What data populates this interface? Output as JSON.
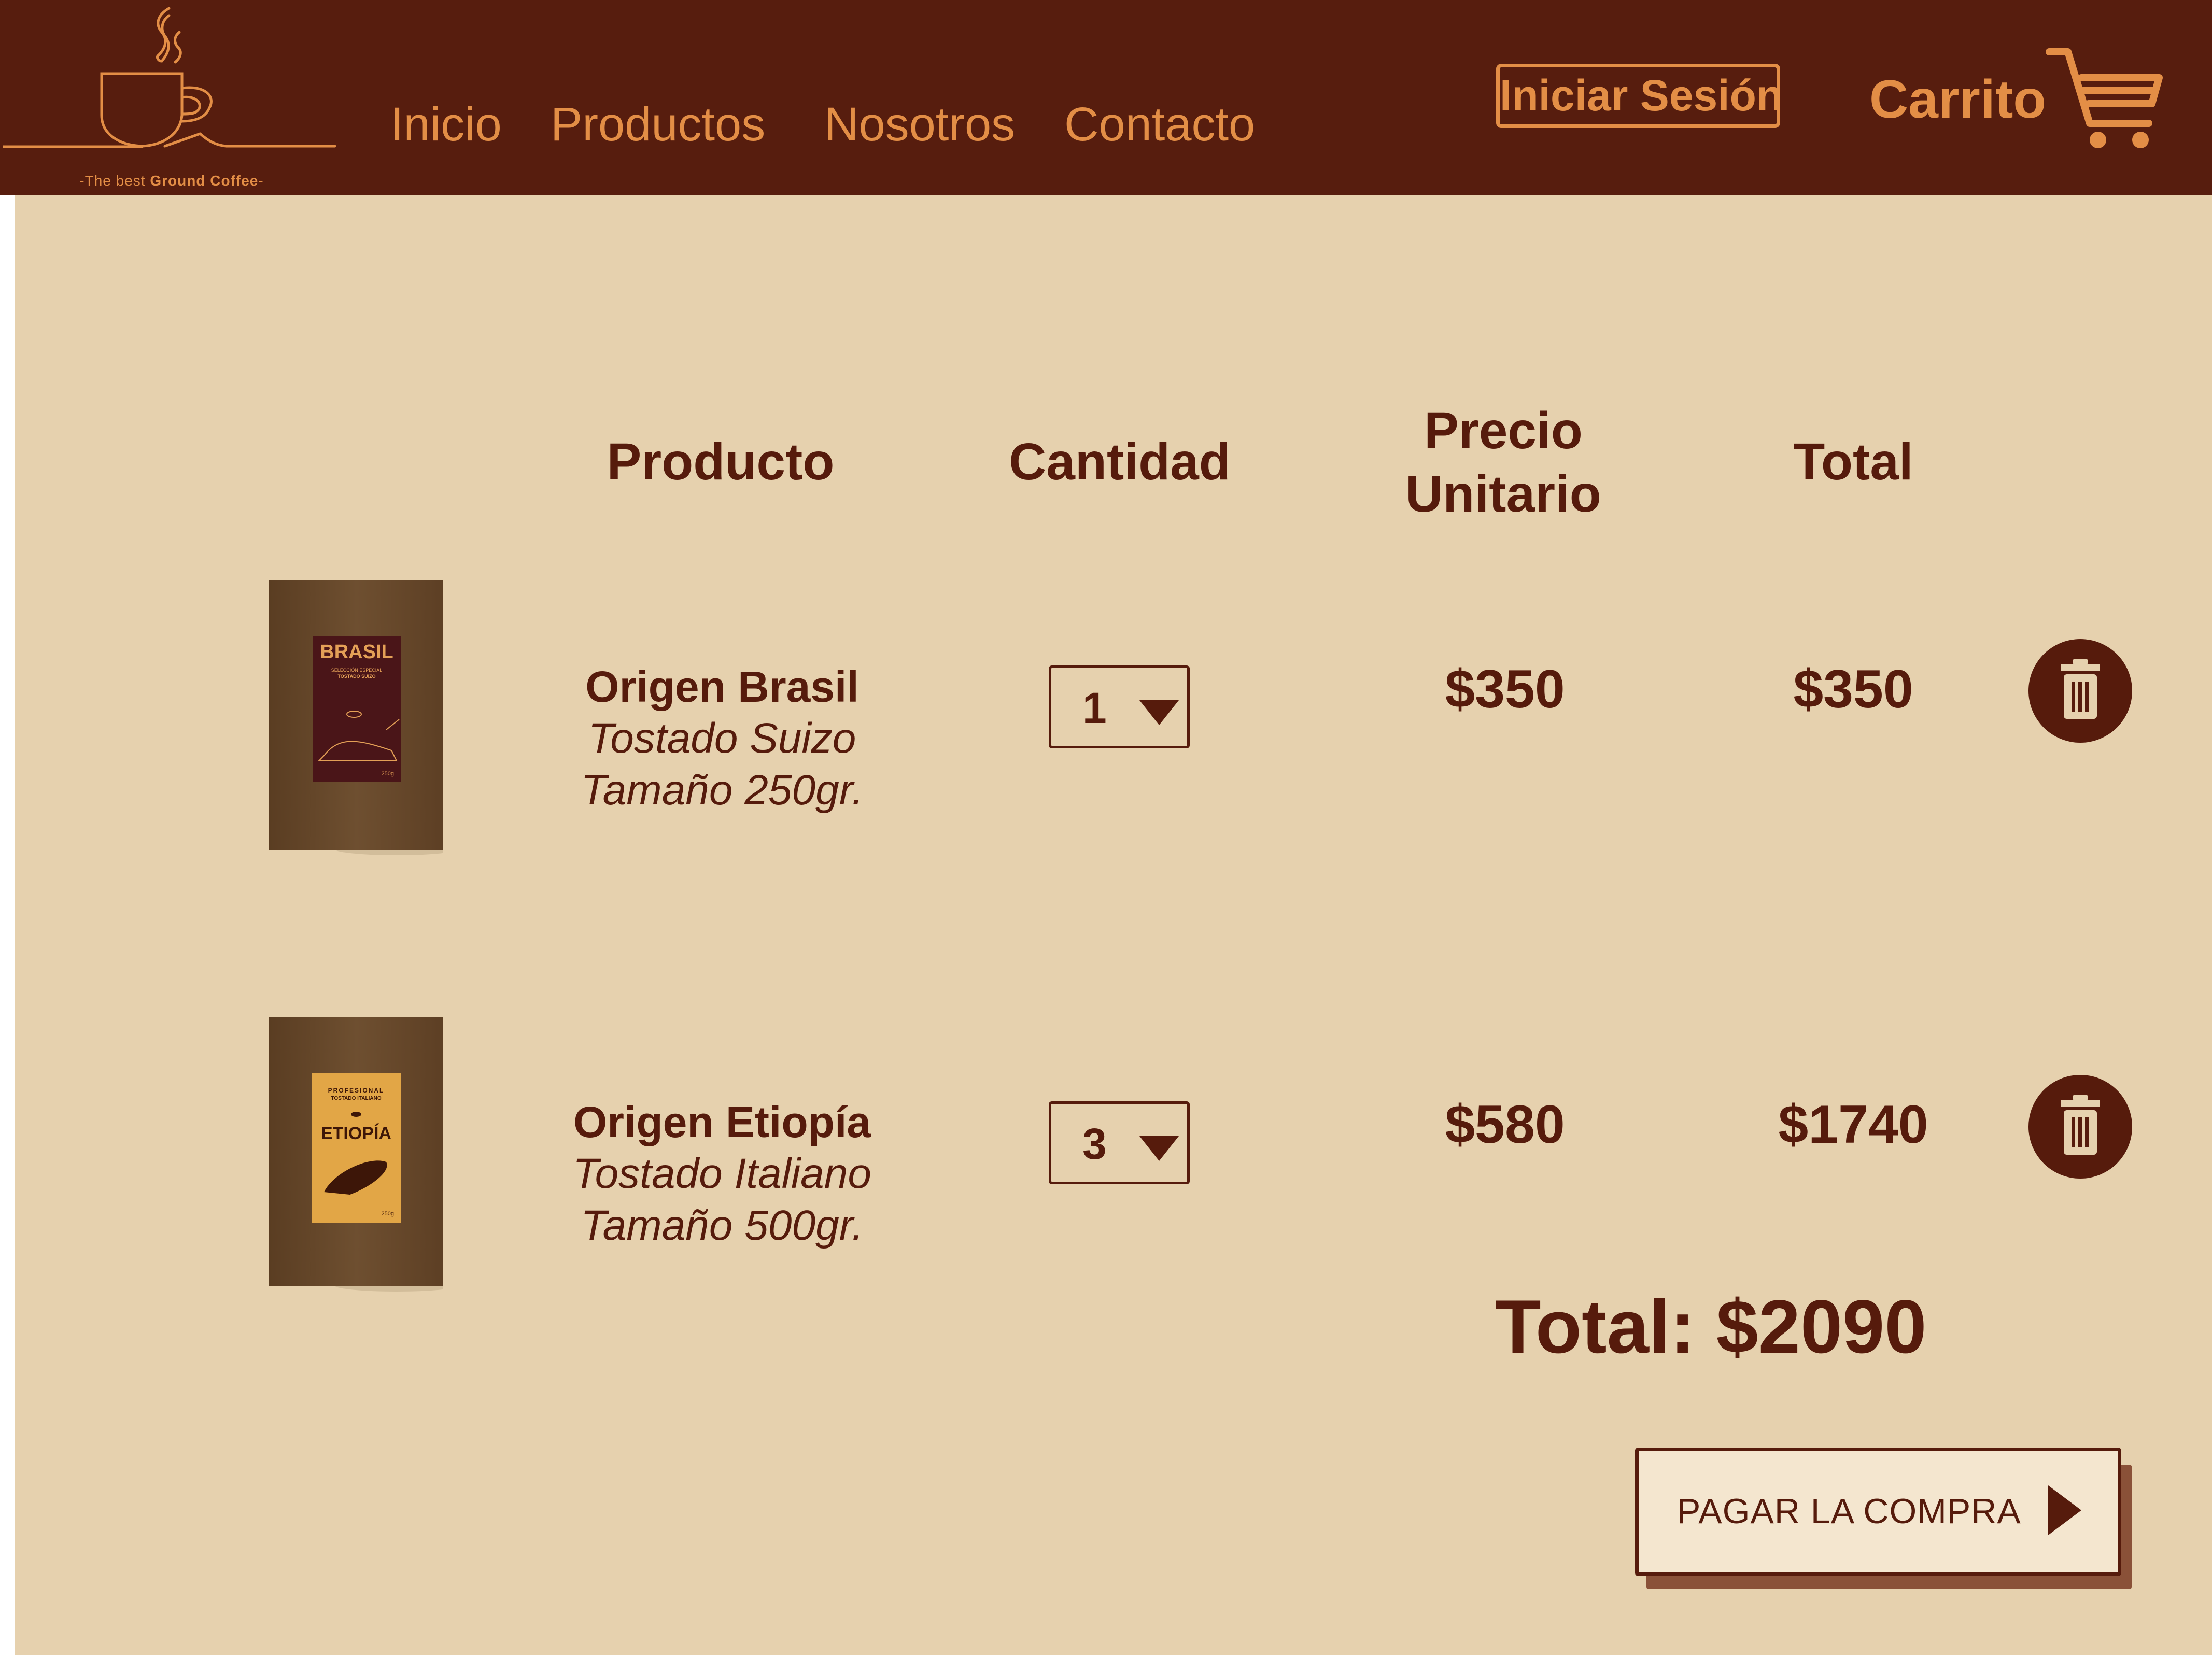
{
  "colors": {
    "header_bg": "#571d0e",
    "accent": "#e38e46",
    "page_bg": "#e6d1ae",
    "text": "#561b0c",
    "bag_brown": "#6a4a2a"
  },
  "header": {
    "logo": {
      "icon": "coffee-cup-logo-icon",
      "tagline_prefix": "-The best ",
      "tagline_brand": "Ground Coffee",
      "tagline_suffix": "-"
    },
    "nav": [
      "Inicio",
      "Productos",
      "Nosotros",
      "Contacto"
    ],
    "login_label": "Iniciar Sesión",
    "cart_label": "Carrito",
    "cart_icon": "shopping-cart-icon"
  },
  "table": {
    "headers": {
      "product": "Producto",
      "quantity": "Cantidad",
      "unit_price_line1": "Precio",
      "unit_price_line2": "Unitario",
      "total": "Total"
    },
    "rows": [
      {
        "name": "Origen Brasil",
        "roast": "Tostado Suizo",
        "size": "Tamaño 250gr.",
        "quantity": "1",
        "unit_price": "$350",
        "total": "$350",
        "image_label": "BRASIL",
        "image_sub": "SELECCIÓN ESPECIAL",
        "image_sub2": "TOSTADO SUIZO",
        "image_weight": "250g",
        "delete_icon": "trash-icon"
      },
      {
        "name": "Origen Etiopía",
        "roast": "Tostado Italiano",
        "size": "Tamaño 500gr.",
        "quantity": "3",
        "unit_price": "$580",
        "total": "$1740",
        "image_label": "ETIOPÍA",
        "image_sub": "PROFESIONAL",
        "image_sub2": "TOSTADO ITALIANO",
        "image_weight": "250g",
        "delete_icon": "trash-icon"
      }
    ]
  },
  "summary": {
    "total_text": "Total: $2090",
    "pay_label": "PAGAR LA COMPRA",
    "pay_icon": "play-arrow-icon"
  }
}
